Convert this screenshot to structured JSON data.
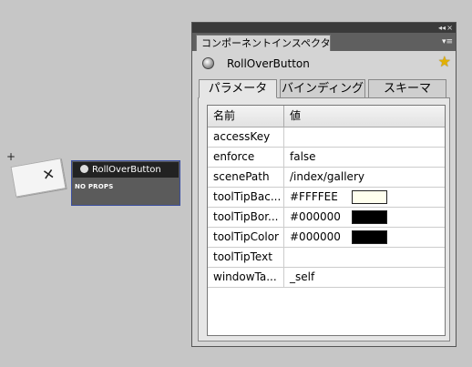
{
  "stage": {
    "crosshair": "+",
    "placeholder_mark": "✕",
    "component": {
      "label": "RollOverButton",
      "subtitle": "NO PROPS"
    }
  },
  "panel": {
    "title": "コンポーネントインスペクタ",
    "collapse_glyph": "◂◂",
    "close_glyph": "×",
    "menu_glyph": "▾≡",
    "component_name": "RollOverButton",
    "star_glyph": "★",
    "tabs": [
      {
        "label": "パラメータ",
        "active": true
      },
      {
        "label": "バインディング",
        "active": false
      },
      {
        "label": "スキーマ",
        "active": false
      }
    ],
    "grid": {
      "headers": [
        "名前",
        "値"
      ],
      "rows": [
        {
          "name": "accessKey",
          "value": ""
        },
        {
          "name": "enforce",
          "value": "false"
        },
        {
          "name": "scenePath",
          "value": "/index/gallery"
        },
        {
          "name": "toolTipBac...",
          "value": "#FFFFEE",
          "swatch": "#FFFFEE"
        },
        {
          "name": "toolTipBor...",
          "value": "#000000",
          "swatch": "#000000"
        },
        {
          "name": "toolTipColor",
          "value": "#000000",
          "swatch": "#000000"
        },
        {
          "name": "toolTipText",
          "value": ""
        },
        {
          "name": "windowTa...",
          "value": "_self"
        }
      ]
    }
  },
  "colors": {
    "stage_bg": "#c6c6c6",
    "panel_bg": "#d4d4d4",
    "panel_header": "#3a3a3a",
    "selection_border": "#3b4fa0"
  }
}
